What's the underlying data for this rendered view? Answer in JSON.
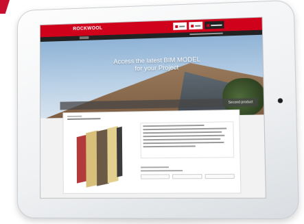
{
  "brand": {
    "logo_text": "ROCKWOOL"
  },
  "hero": {
    "title_line1": "Access the latest BIM MODEL",
    "title_line2": "for your Project",
    "cta_label": "Second product"
  },
  "colors": {
    "brand_red": "#d0021b",
    "nav_dark": "#222222"
  }
}
